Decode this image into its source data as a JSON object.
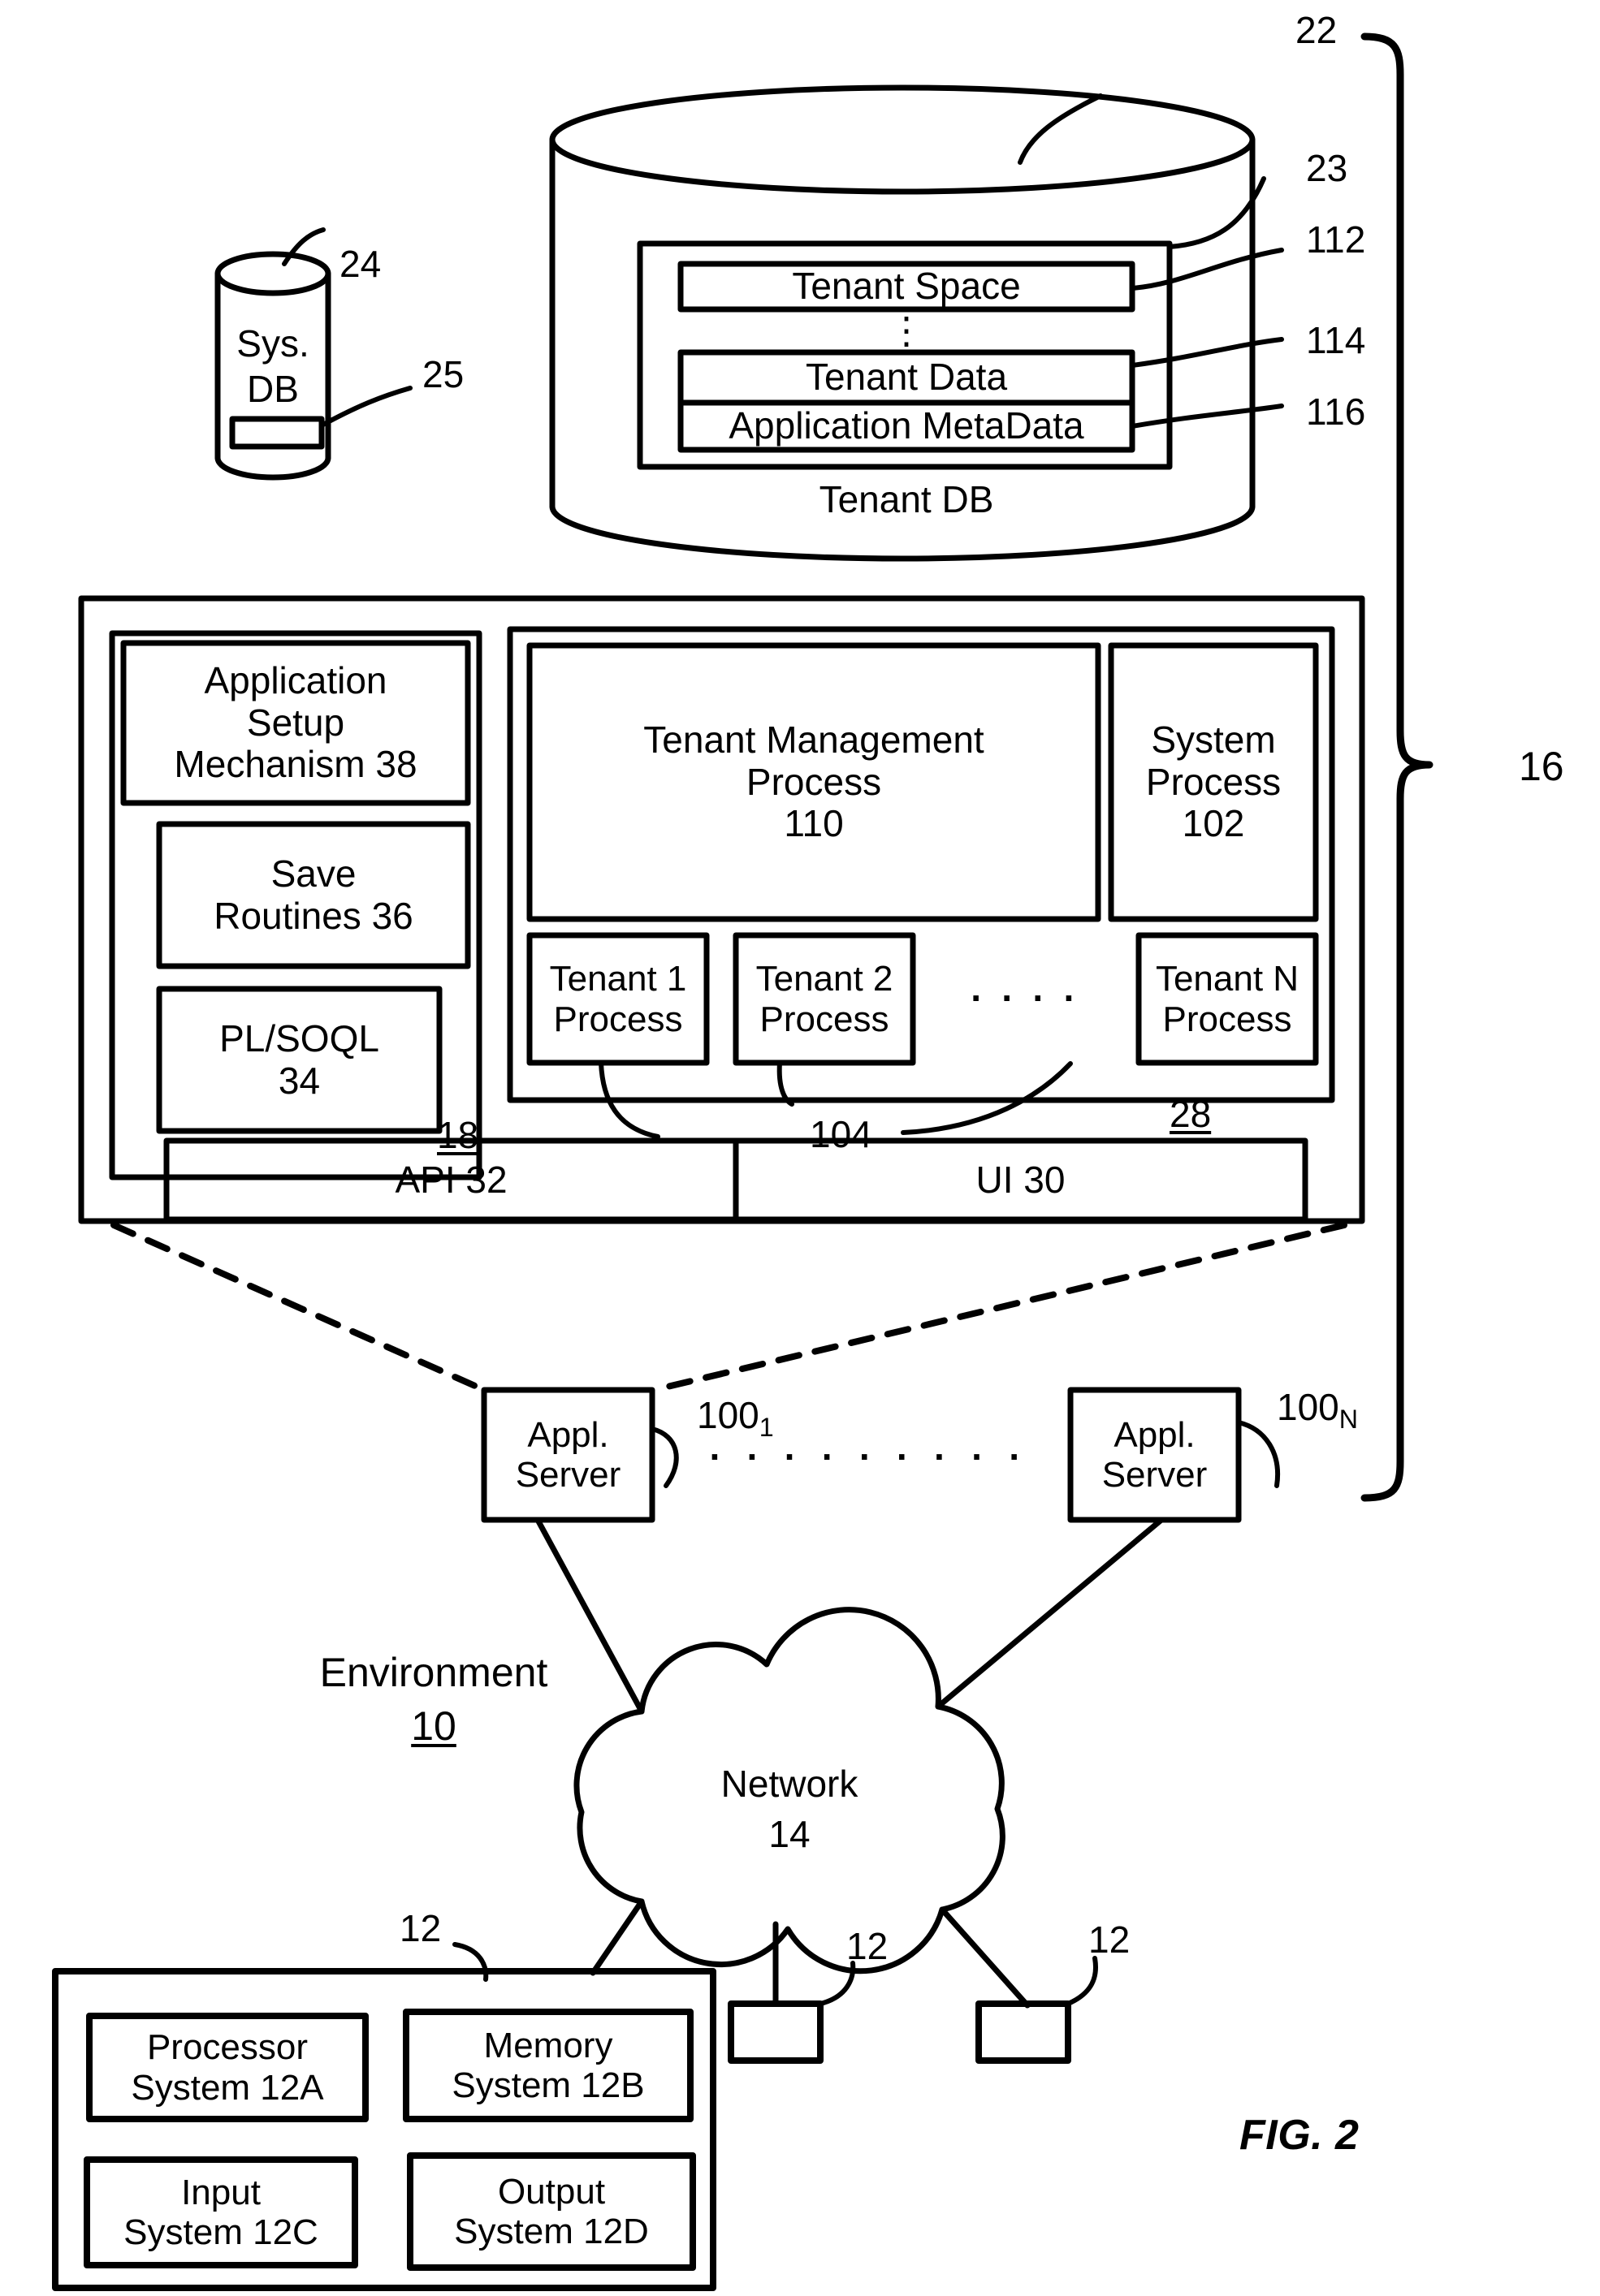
{
  "figure": {
    "caption": "FIG. 2",
    "bracket_ref": "16"
  },
  "tenant_db": {
    "cylinder_ref": "22",
    "container_ref": "23",
    "bottom_label": "Tenant DB",
    "vertical_ellipsis": "⋮",
    "rows": [
      {
        "label": "Tenant Space",
        "ref": "112"
      },
      {
        "label": "Tenant Data",
        "ref": "114"
      },
      {
        "label": "Application MetaData",
        "ref": "116"
      }
    ]
  },
  "sys_db": {
    "line1": "Sys.",
    "line2": "DB",
    "cylinder_ref": "24",
    "slot_ref": "25"
  },
  "server_block": {
    "left_group": {
      "ref": "18",
      "items": [
        {
          "lines": [
            "Application",
            "Setup",
            "Mechanism 38"
          ]
        },
        {
          "lines": [
            "Save",
            "Routines 36"
          ]
        },
        {
          "lines": [
            "PL/SOQL",
            "34"
          ]
        }
      ]
    },
    "process_group": {
      "ref": "28",
      "tenant_mgmt": {
        "lines": [
          "Tenant Management",
          "Process",
          "110"
        ]
      },
      "system_process": {
        "lines": [
          "System",
          "Process",
          "102"
        ]
      },
      "tenant_processes": [
        {
          "lines": [
            "Tenant 1",
            "Process"
          ]
        },
        {
          "lines": [
            "Tenant 2",
            "Process"
          ]
        },
        {
          "lines": [
            "Tenant N",
            "Process"
          ]
        }
      ],
      "ellipsis": "· · · ·",
      "process_ref": "104"
    },
    "bottom_bar": [
      {
        "label": "API 32"
      },
      {
        "label": "UI 30"
      }
    ]
  },
  "app_servers": {
    "ellipsis": "· · · · · · · · ·",
    "first": {
      "lines": [
        "Appl.",
        "Server"
      ],
      "ref_base": "100",
      "ref_sub": "1"
    },
    "last": {
      "lines": [
        "Appl.",
        "Server"
      ],
      "ref_base": "100",
      "ref_sub": "N"
    }
  },
  "environment": {
    "label": "Environment",
    "ref": "10"
  },
  "network": {
    "line1": "Network",
    "line2": "14"
  },
  "user_systems": {
    "ref": "12",
    "terminal_refs": [
      "12",
      "12"
    ],
    "boxes": [
      {
        "lines": [
          "Processor",
          "System 12A"
        ]
      },
      {
        "lines": [
          "Memory",
          "System 12B"
        ]
      },
      {
        "lines": [
          "Input",
          "System 12C"
        ]
      },
      {
        "lines": [
          "Output",
          "System 12D"
        ]
      }
    ]
  }
}
